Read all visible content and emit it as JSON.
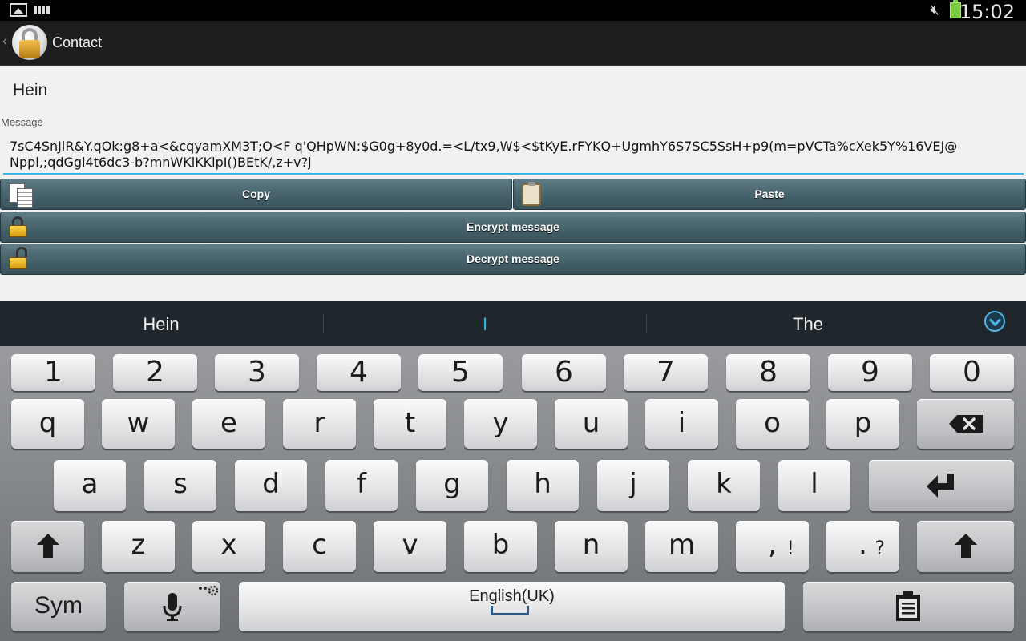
{
  "status_bar": {
    "time": "15:02"
  },
  "app": {
    "title": "Contact"
  },
  "contact": {
    "name": "Hein"
  },
  "message": {
    "label": "Message",
    "value": "7sC4SnJlR&Y.qOk:g8+a<&cqyamXM3T;O<F q'QHpWN:$G0g+8y0d.=<L/tx9,W$<$tKyE.rFYKQ+UgmhY6S7SC5SsH+p9(m=pVCTa%cXek5Y%16VEJ@\nNppl,;qdGgl4t6dc3-b?mnWKlKKlpI()BEtK/,z+v?j"
  },
  "buttons": {
    "copy": "Copy",
    "paste": "Paste",
    "encrypt": "Encrypt message",
    "decrypt": "Decrypt message"
  },
  "suggestions": [
    "Hein",
    "I",
    "The"
  ],
  "keyboard": {
    "numbers": [
      "1",
      "2",
      "3",
      "4",
      "5",
      "6",
      "7",
      "8",
      "9",
      "0"
    ],
    "row1": [
      "q",
      "w",
      "e",
      "r",
      "t",
      "y",
      "u",
      "i",
      "o",
      "p"
    ],
    "row2": [
      "a",
      "s",
      "d",
      "f",
      "g",
      "h",
      "j",
      "k",
      "l"
    ],
    "row3": [
      "z",
      "x",
      "c",
      "v",
      "b",
      "n",
      "m"
    ],
    "comma_key": {
      "main": ",",
      "sub": "!"
    },
    "period_key": {
      "main": ".",
      "sub": "?"
    },
    "sym": "Sym",
    "language": "English(UK)"
  },
  "colors": {
    "accent": "#33b5e5",
    "button": "#4a6870",
    "keyboard_bg": "#7f8286"
  },
  "icons": [
    "image-icon",
    "keyboard-icon",
    "mute-icon",
    "battery-icon",
    "back-chevron-icon",
    "app-lock-icon",
    "copy-icon",
    "paste-icon",
    "lock-icon",
    "unlock-icon",
    "expand-icon",
    "backspace-icon",
    "enter-icon",
    "shift-icon",
    "mic-icon",
    "settings-icon",
    "clipboard-icon"
  ]
}
